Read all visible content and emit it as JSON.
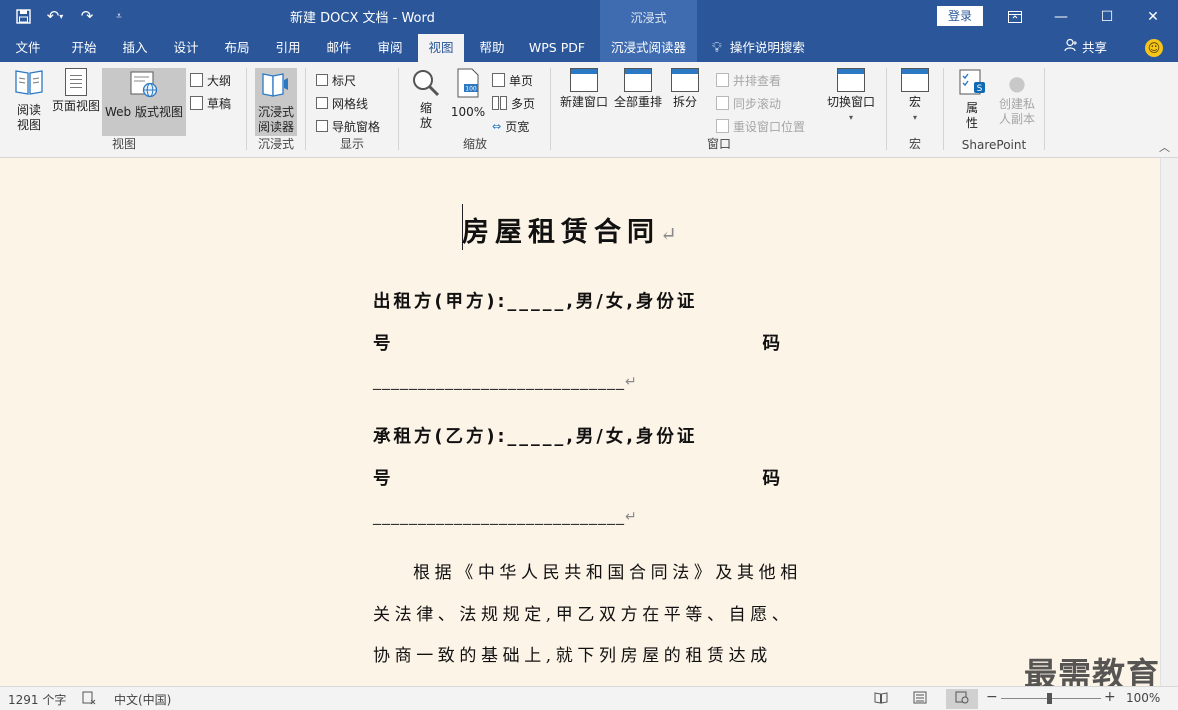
{
  "titlebar": {
    "doc_title": "新建 DOCX 文档  -  Word",
    "context_tab_group": "沉浸式",
    "login_label": "登录"
  },
  "tabs": [
    "文件",
    "开始",
    "插入",
    "设计",
    "布局",
    "引用",
    "邮件",
    "审阅",
    "视图",
    "帮助",
    "WPS PDF",
    "沉浸式阅读器"
  ],
  "active_tab": "视图",
  "tell_me": "操作说明搜索",
  "share_label": "共享",
  "ribbon": {
    "views": {
      "label": "视图",
      "read_mode": "阅读\n视图",
      "print_layout": "页面视图",
      "web_layout": "Web 版式视图",
      "outline": "大纲",
      "draft": "草稿"
    },
    "immersive": {
      "label": "沉浸式",
      "immersive_reader": "沉浸式\n阅读器"
    },
    "show": {
      "label": "显示",
      "ruler": "标尺",
      "gridlines": "网格线",
      "nav_pane": "导航窗格"
    },
    "zoom": {
      "label": "缩放",
      "zoom": "缩\n放",
      "hundred": "100%",
      "one_page": "单页",
      "multi_page": "多页",
      "page_width": "页宽"
    },
    "window": {
      "label": "窗口",
      "new_window": "新建窗口",
      "arrange_all": "全部重排",
      "split": "拆分",
      "side_by_side": "并排查看",
      "sync_scroll": "同步滚动",
      "reset_position": "重设窗口位置",
      "switch_windows": "切换窗口"
    },
    "macros": {
      "label": "宏",
      "macros": "宏"
    },
    "sharepoint": {
      "label": "SharePoint",
      "properties": "属\n性",
      "private_copy": "创建私\n人副本"
    }
  },
  "document": {
    "heading": "房屋租赁合同",
    "lessor_line1": "出租方(甲方):_____,男/女,身份证",
    "lessor_line2_left": "号",
    "lessor_line2_right": "码",
    "lessor_line3": "____________________________",
    "lessee_line1": "承租方(乙方):_____,男/女,身份证",
    "lessee_line2_left": "号",
    "lessee_line2_right": "码",
    "lessee_line3": "____________________________",
    "body1": "    根据《中华人民共和国合同法》及其他相",
    "body2": "关法律、法规规定,甲乙双方在平等、自愿、",
    "body3": "协商一致的基础上,就下列房屋的租赁达成",
    "para_mark": "↵"
  },
  "watermark": "最需教育",
  "statusbar": {
    "word_count": "1291 个字",
    "language": "中文(中国)",
    "zoom": "100%"
  }
}
